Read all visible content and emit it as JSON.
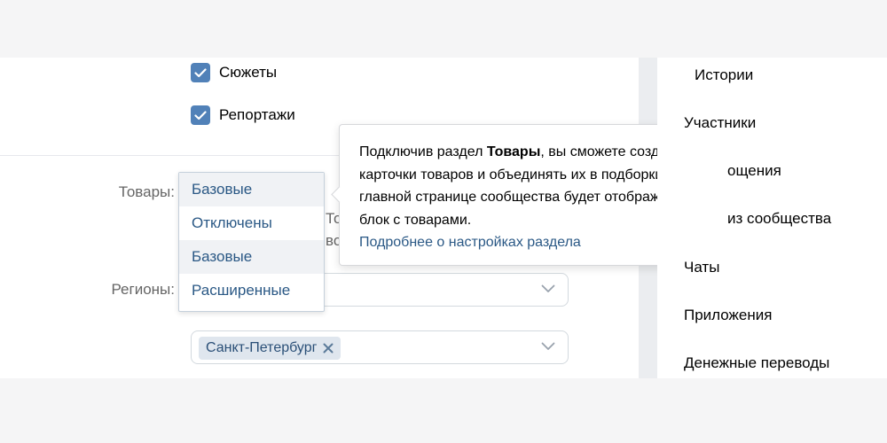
{
  "sections": {
    "checkboxes": [
      {
        "label": "Сюжеты",
        "checked": true
      },
      {
        "label": "Репортажи",
        "checked": true
      }
    ]
  },
  "goods_field": {
    "label": "Товары:",
    "value": "Базовые",
    "options": [
      "Отключены",
      "Базовые",
      "Расширенные"
    ]
  },
  "regions_field": {
    "label": "Регионы:",
    "tag": "Санкт-Петербург"
  },
  "obscured": {
    "line1": "То",
    "line2": "во"
  },
  "tooltip": {
    "text_before": "Подключив раздел ",
    "text_bold": "Товары",
    "text_after": ", вы сможете создавать карточки товаров и объединять их в подборки. На главной странице сообщества будет отображаться блок с товарами.",
    "link": "Подробнее о настройках раздела"
  },
  "right_nav": {
    "items": [
      "Истории",
      "Участники",
      "ощения",
      "из сообщества",
      "Чаты",
      "Приложения",
      "Денежные переводы"
    ]
  },
  "colors": {
    "accent": "#5181b8",
    "link": "#2a5885",
    "background": "#ebedf0"
  },
  "icons": [
    "checkbox-check-icon",
    "chevron-down-icon",
    "close-icon"
  ]
}
